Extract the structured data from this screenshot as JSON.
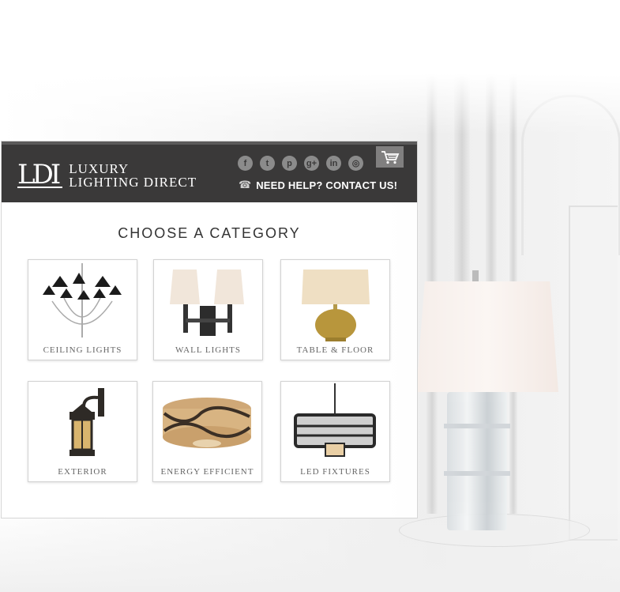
{
  "brand": {
    "logo_mark": "LDI",
    "line1": "LUXURY",
    "line2": "LIGHTING DIRECT"
  },
  "header": {
    "social": [
      {
        "name": "facebook-icon",
        "glyph": "f"
      },
      {
        "name": "twitter-icon",
        "glyph": "t"
      },
      {
        "name": "pinterest-icon",
        "glyph": "p"
      },
      {
        "name": "googleplus-icon",
        "glyph": "g+"
      },
      {
        "name": "linkedin-icon",
        "glyph": "in"
      },
      {
        "name": "instagram-icon",
        "glyph": "◎"
      }
    ],
    "help_text": "NEED HELP? CONTACT US!",
    "phone_glyph": "☎"
  },
  "main": {
    "title": "CHOOSE A CATEGORY",
    "categories": [
      {
        "label": "CEILING LIGHTS"
      },
      {
        "label": "WALL LIGHTS"
      },
      {
        "label": "TABLE & FLOOR"
      },
      {
        "label": "EXTERIOR"
      },
      {
        "label": "ENERGY EFFICIENT"
      },
      {
        "label": "LED FIXTURES"
      }
    ]
  },
  "colors": {
    "header_bg": "#3a3939",
    "icon_gray": "#8b8b8b",
    "label_gray": "#666666"
  }
}
